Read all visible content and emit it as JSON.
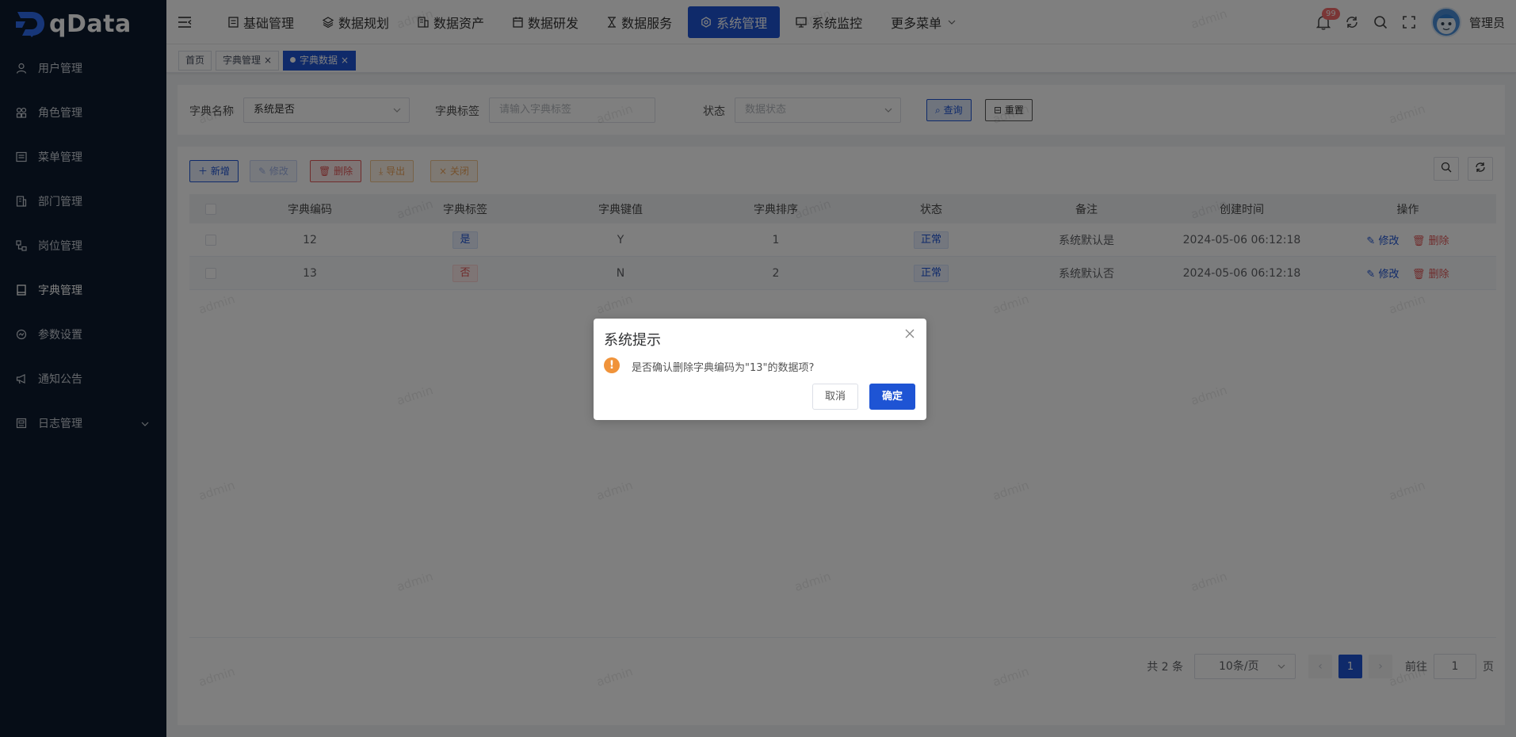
{
  "app": {
    "logo_text": "qData"
  },
  "sidebar": {
    "items": [
      {
        "label": "用户管理",
        "icon": "user-icon"
      },
      {
        "label": "角色管理",
        "icon": "roles-icon"
      },
      {
        "label": "菜单管理",
        "icon": "menu-list-icon"
      },
      {
        "label": "部门管理",
        "icon": "department-icon"
      },
      {
        "label": "岗位管理",
        "icon": "post-icon"
      },
      {
        "label": "字典管理",
        "icon": "dictionary-icon"
      },
      {
        "label": "参数设置",
        "icon": "settings-icon"
      },
      {
        "label": "通知公告",
        "icon": "megaphone-icon"
      },
      {
        "label": "日志管理",
        "icon": "log-icon"
      }
    ]
  },
  "header": {
    "nav": [
      {
        "label": "基础管理"
      },
      {
        "label": "数据规划"
      },
      {
        "label": "数据资产"
      },
      {
        "label": "数据研发"
      },
      {
        "label": "数据服务"
      },
      {
        "label": "系统管理"
      },
      {
        "label": "系统监控"
      },
      {
        "label": "更多菜单"
      }
    ],
    "notification_count": "99",
    "user_name": "管理员"
  },
  "tags": {
    "home": "首页",
    "dict_manage": "字典管理",
    "dict_data": "字典数据"
  },
  "search": {
    "dict_name_label": "字典名称",
    "dict_name_value": "系统是否",
    "dict_label_label": "字典标签",
    "dict_label_placeholder": "请输入字典标签",
    "status_label": "状态",
    "status_placeholder": "数据状态",
    "query_btn": "查询",
    "reset_btn": "重置"
  },
  "toolbar": {
    "add": "新增",
    "edit": "修改",
    "delete": "删除",
    "export": "导出",
    "close": "关闭"
  },
  "table": {
    "headers": [
      "字典编码",
      "字典标签",
      "字典键值",
      "字典排序",
      "状态",
      "备注",
      "创建时间",
      "操作"
    ],
    "rows": [
      {
        "code": "12",
        "label": "是",
        "value": "Y",
        "sort": "1",
        "status": "正常",
        "remark": "系统默认是",
        "created": "2024-05-06 06:12:18"
      },
      {
        "code": "13",
        "label": "否",
        "value": "N",
        "sort": "2",
        "status": "正常",
        "remark": "系统默认否",
        "created": "2024-05-06 06:12:18"
      }
    ],
    "op_edit": "修改",
    "op_delete": "删除"
  },
  "pagination": {
    "total": "共 2 条",
    "page_size": "10条/页",
    "current": "1",
    "goto_label": "前往",
    "goto_value": "1",
    "page_suffix": "页"
  },
  "watermark": "admin",
  "dialog": {
    "title": "系统提示",
    "message": "是否确认删除字典编码为\"13\"的数据项?",
    "cancel": "取消",
    "confirm": "确定"
  },
  "colors": {
    "sidebar_bg": "#0d1b2e",
    "primary": "#1e54d4",
    "danger": "#e05858",
    "warning": "#f0933a"
  }
}
